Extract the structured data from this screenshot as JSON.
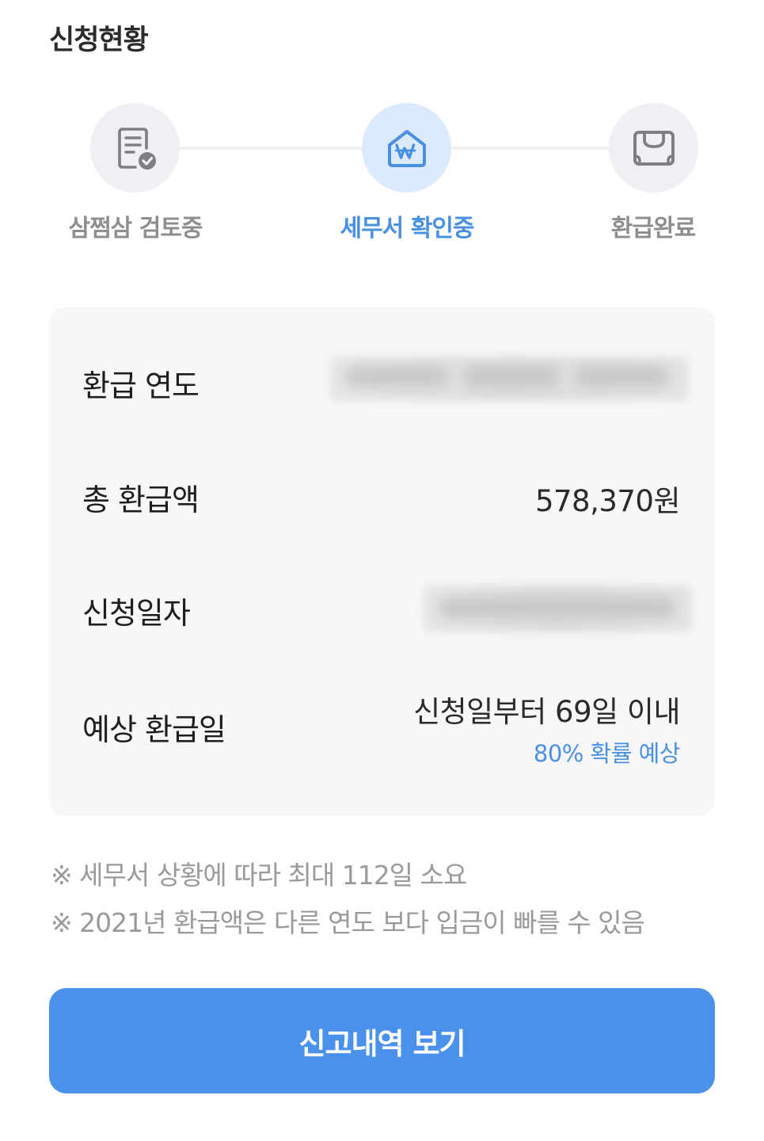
{
  "section": {
    "title": "신청현황"
  },
  "steps": [
    {
      "label": "삼쩜삼 검토중",
      "icon": "document-check-icon",
      "active": false
    },
    {
      "label": "세무서 확인중",
      "icon": "tax-office-won-icon",
      "active": true
    },
    {
      "label": "환급완료",
      "icon": "money-box-icon",
      "active": false
    }
  ],
  "colors": {
    "accent": "#4a90e2",
    "button": "#4a91eb",
    "inactive_text": "#8e8e8e",
    "card_bg": "#f7f7f8"
  },
  "card": {
    "rows": [
      {
        "label": "환급 연도",
        "value_blurred": true
      },
      {
        "label": "총 환급액",
        "value": "578,370원"
      },
      {
        "label": "신청일자",
        "value_blurred": true
      },
      {
        "label": "예상 환급일",
        "value": "신청일부터 69일 이내",
        "sub_value": "80% 확률 예상"
      }
    ]
  },
  "notes": [
    "※ 세무서 상황에 따라 최대 112일 소요",
    "※ 2021년 환급액은 다른 연도 보다 입금이 빠를 수 있음"
  ],
  "button": {
    "label": "신고내역 보기"
  }
}
